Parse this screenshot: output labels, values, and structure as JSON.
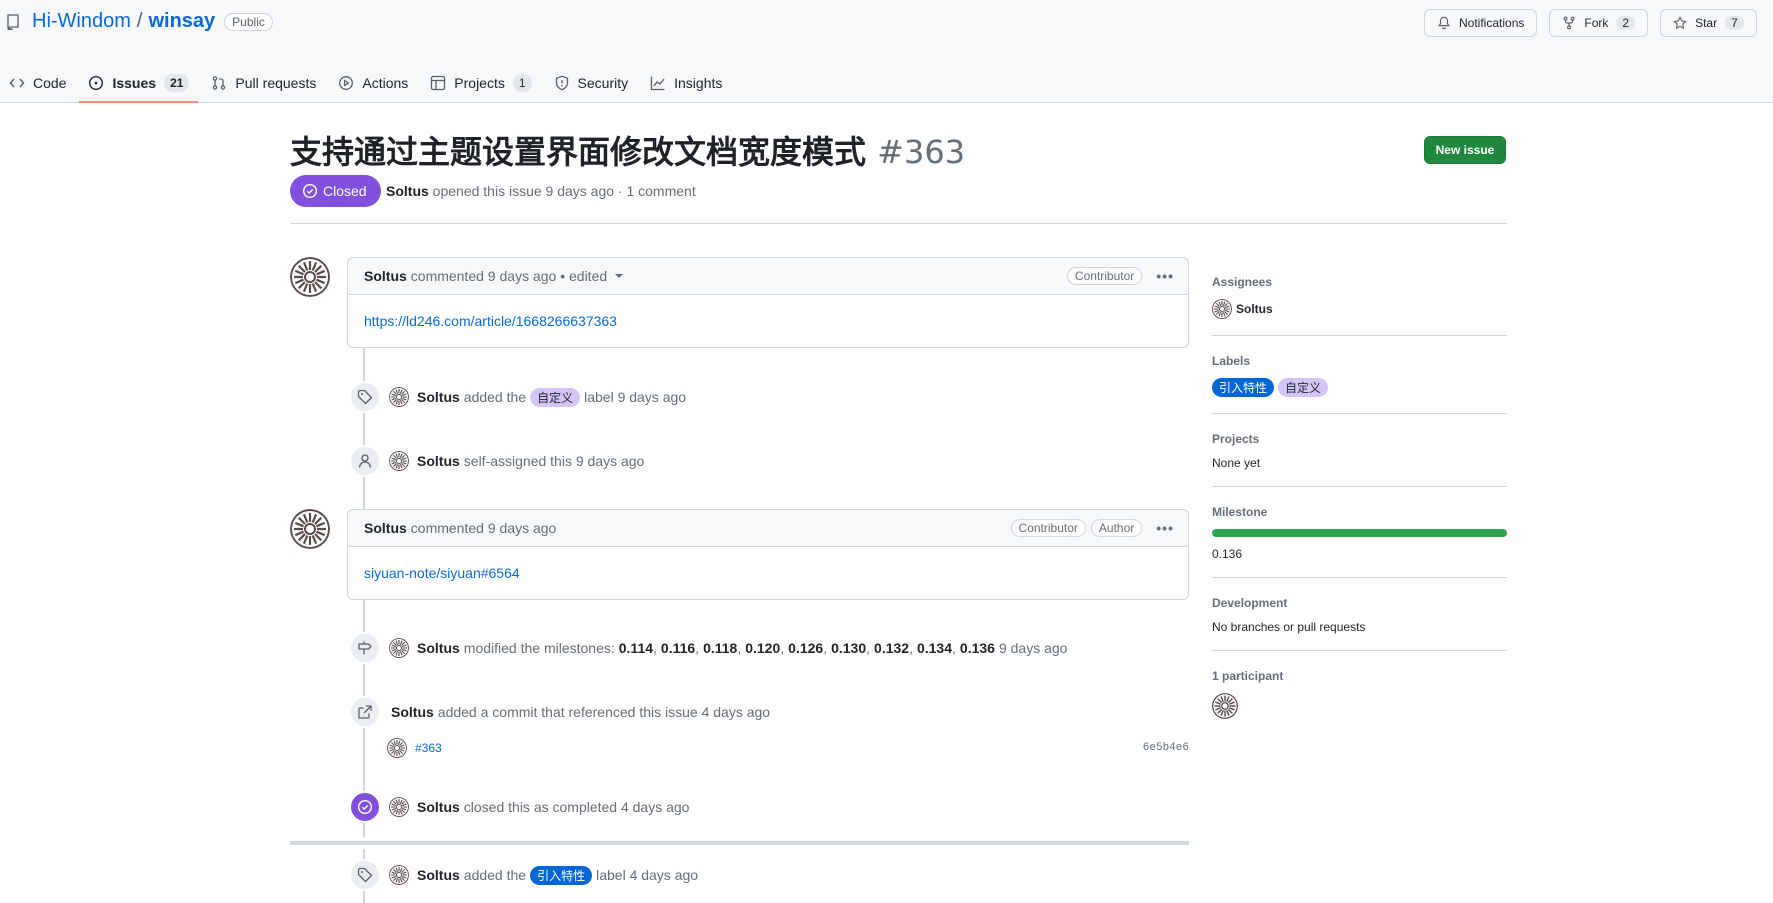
{
  "repo": {
    "owner": "Hi-Windom",
    "slash": "/",
    "name": "winsay",
    "visibility": "Public"
  },
  "header_actions": {
    "notifications": "Notifications",
    "fork_label": "Fork",
    "fork_count": "2",
    "star_label": "Star",
    "star_count": "7"
  },
  "tabs": [
    {
      "label": "Code",
      "icon": "code-icon"
    },
    {
      "label": "Issues",
      "icon": "issue-opened-icon",
      "count": "21",
      "selected": true
    },
    {
      "label": "Pull requests",
      "icon": "git-pull-request-icon"
    },
    {
      "label": "Actions",
      "icon": "play-icon"
    },
    {
      "label": "Projects",
      "icon": "table-icon",
      "count": "1"
    },
    {
      "label": "Security",
      "icon": "shield-icon"
    },
    {
      "label": "Insights",
      "icon": "graph-icon"
    }
  ],
  "issue": {
    "title": "支持通过主题设置界面修改文档宽度模式",
    "number": "#363",
    "new_issue": "New issue",
    "state": "Closed",
    "author": "Soltus",
    "meta_text": "opened this issue 9 days ago · 1 comment"
  },
  "timeline": {
    "comment1": {
      "author": "Soltus",
      "text": "commented 9 days ago • edited",
      "role": "Contributor",
      "body_link": "https://ld246.com/article/1668266637363"
    },
    "event_label1": {
      "author": "Soltus",
      "pre": "added the",
      "label": "自定义",
      "post": "label 9 days ago"
    },
    "event_assign": {
      "author": "Soltus",
      "text": "self-assigned this 9 days ago"
    },
    "comment2": {
      "author": "Soltus",
      "text": "commented 9 days ago",
      "role1": "Contributor",
      "role2": "Author",
      "body_link": "siyuan-note/siyuan#6564"
    },
    "event_milestone": {
      "author": "Soltus",
      "pre": "modified the milestones:",
      "milestones": [
        "0.114",
        "0.116",
        "0.118",
        "0.120",
        "0.126",
        "0.130",
        "0.132",
        "0.134",
        "0.136"
      ],
      "post": "9 days ago"
    },
    "event_commit": {
      "author": "Soltus",
      "text": "added a commit that referenced this issue 4 days ago",
      "commit_msg": "#363",
      "sha": "6e5b4e6"
    },
    "event_closed": {
      "author": "Soltus",
      "text": "closed this as completed 4 days ago"
    },
    "event_label2": {
      "author": "Soltus",
      "pre": "added the",
      "label": "引入特性",
      "post": "label 4 days ago"
    }
  },
  "sidebar": {
    "assignees_h": "Assignees",
    "assignee": "Soltus",
    "labels_h": "Labels",
    "labels": [
      "引入特性",
      "自定义"
    ],
    "projects_h": "Projects",
    "projects_v": "None yet",
    "milestone_h": "Milestone",
    "milestone_progress": 1.0,
    "milestone_v": "0.136",
    "development_h": "Development",
    "development_v": "No branches or pull requests",
    "participants_h": "1 participant"
  },
  "colors": {
    "accent": "#0969da",
    "closed": "#8250df",
    "green": "#1f883d",
    "label_blue": "#0366d6",
    "label_purple": "#d4c5f9"
  }
}
